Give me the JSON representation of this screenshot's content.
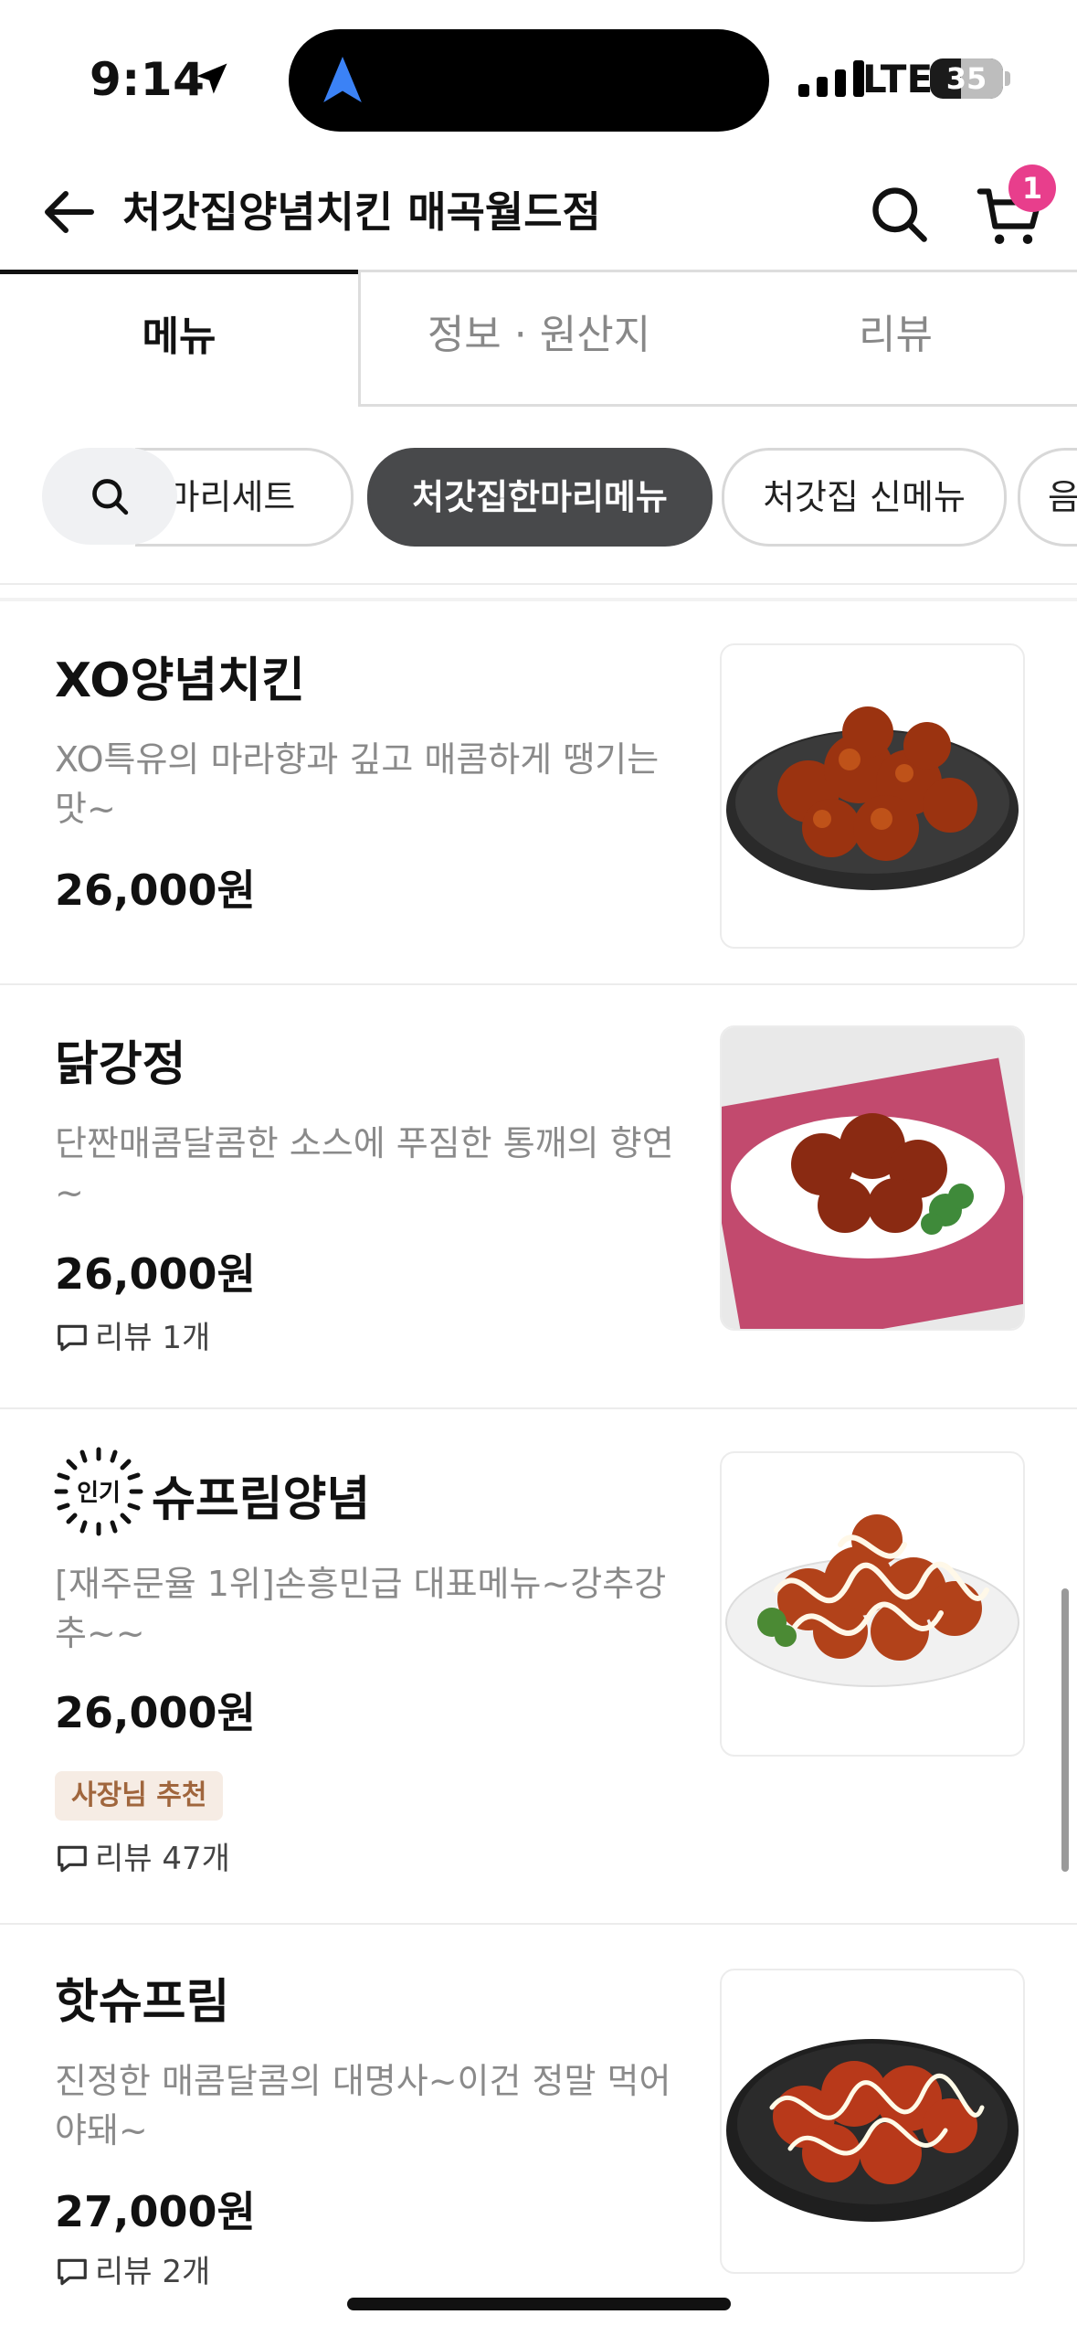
{
  "status_bar": {
    "time": "9:14",
    "network": "LTE",
    "battery": "35"
  },
  "header": {
    "title": "처갓집양념치킨 매곡월드점",
    "cart_count": "1"
  },
  "tabs": [
    {
      "label": "메뉴",
      "active": true
    },
    {
      "label": "정보 · 원산지",
      "active": false
    },
    {
      "label": "리뷰",
      "active": false
    }
  ],
  "categories": [
    {
      "label": "한마리세트"
    },
    {
      "label": "처갓집한마리메뉴",
      "selected": true
    },
    {
      "label": "처갓집 신메뉴"
    },
    {
      "label": "음료"
    }
  ],
  "menu_items": [
    {
      "name": "XO양념치킨",
      "description": "XO특유의 마라향과 깊고 매콤하게 땡기는 맛~",
      "price": "26,000원",
      "review": ""
    },
    {
      "name": "닭강정",
      "description": "단짠매콤달콤한 소스에 푸짐한 통깨의 향연~",
      "price": "26,000원",
      "review": "리뷰 1개"
    },
    {
      "name": "슈프림양념",
      "badge_popular": "인기",
      "description": "[재주문율 1위]손흥민급 대표메뉴~강추강추~~",
      "price": "26,000원",
      "owner_badge": "사장님 추천",
      "review": "리뷰 47개"
    },
    {
      "name": "핫슈프림",
      "description": "진정한 매콤달콤의 대명사~이건 정말 먹어야돼~",
      "price": "27,000원",
      "review": "리뷰 2개"
    }
  ],
  "colors": {
    "accent_pink": "#e83e8c",
    "chip_selected": "#48494b",
    "owner_badge_text": "#a0663d"
  }
}
